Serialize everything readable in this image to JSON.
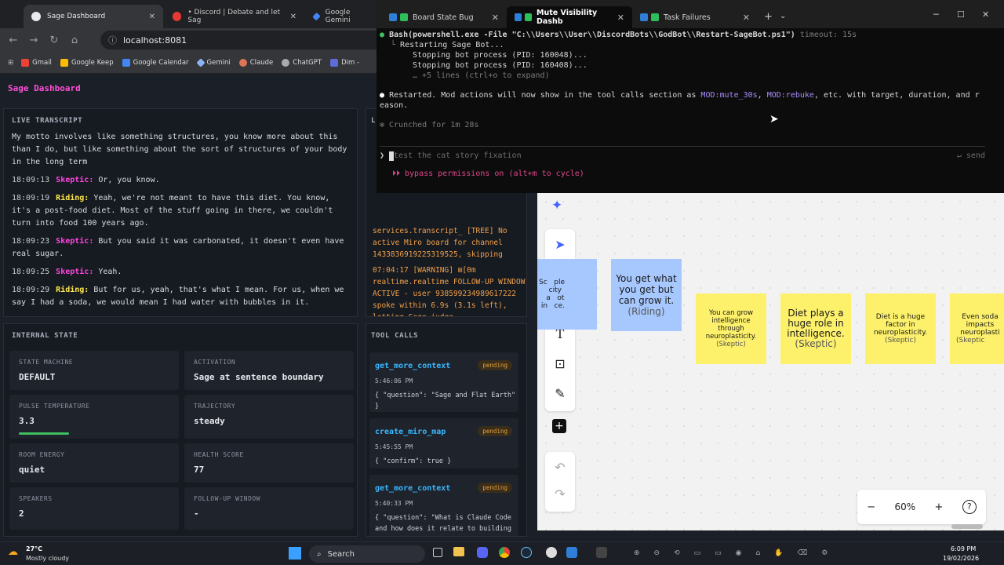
{
  "browser": {
    "tabs": [
      {
        "title": "Sage Dashboard",
        "active": true
      },
      {
        "title": "• Discord | Debate and let Sag"
      },
      {
        "title": "Google Gemini"
      }
    ],
    "url": "localhost:8081",
    "bookmarks": [
      "Gmail",
      "Google Keep",
      "Google Calendar",
      "Gemini",
      "Claude",
      "ChatGPT",
      "Dim -"
    ]
  },
  "dashboard": {
    "title": "Sage Dashboard",
    "transcript": {
      "header": "LIVE TRANSCRIPT",
      "lines": [
        {
          "time": "",
          "speaker": "",
          "text": "My motto involves like something structures, you know more about this than I do, but like something about the sort of structures of your body in the long term"
        },
        {
          "time": "18:09:13",
          "speaker": "Skeptic:",
          "text": "Or, you know."
        },
        {
          "time": "18:09:19",
          "speaker": "Riding:",
          "text": "Yeah, we're not meant to have this diet. You know, it's a post-food diet. Most of the stuff going in there, we couldn't turn into food 100 years ago."
        },
        {
          "time": "18:09:23",
          "speaker": "Skeptic:",
          "text": "But you said it was carbonated, it doesn't even have real sugar."
        },
        {
          "time": "18:09:25",
          "speaker": "Skeptic:",
          "text": "Yeah."
        },
        {
          "time": "18:09:29",
          "speaker": "Riding:",
          "text": "But for us, yeah, that's what I mean. For us, when we say I had a soda, we would mean I had water with bubbles in it."
        }
      ]
    },
    "logs": {
      "header": "L",
      "entries": [
        "services.transcript_ [TREE] No active Miro board for channel 1433836919225319525, skipping",
        "07:04:17  [WARNING] ⊠[0m realtime.realtime FOLLOW-UP WINDOW ACTIVE - user 938599234989617222 spoke within 6.9s (3.1s left), letting Sage judge"
      ]
    },
    "internal_state": {
      "header": "INTERNAL STATE",
      "cards": [
        {
          "label": "STATE MACHINE",
          "value": "DEFAULT"
        },
        {
          "label": "ACTIVATION",
          "value": "Sage at sentence boundary"
        },
        {
          "label": "PULSE TEMPERATURE",
          "value": "3.3"
        },
        {
          "label": "TRAJECTORY",
          "value": "steady"
        },
        {
          "label": "ROOM ENERGY",
          "value": "quiet"
        },
        {
          "label": "HEALTH SCORE",
          "value": "77"
        },
        {
          "label": "SPEAKERS",
          "value": "2"
        },
        {
          "label": "FOLLOW-UP WINDOW",
          "value": "-"
        }
      ]
    },
    "tool_calls": {
      "header": "TOOL CALLS",
      "items": [
        {
          "name": "get_more_context",
          "status": "pending",
          "time": "5:46:06 PM",
          "args": "{ \"question\": \"Sage and Flat Earth\" }"
        },
        {
          "name": "create_miro_map",
          "status": "pending",
          "time": "5:45:55 PM",
          "args": "{ \"confirm\": true }"
        },
        {
          "name": "get_more_context",
          "status": "pending",
          "time": "5:40:33 PM",
          "args": "{ \"question\": \"What is Claude Code and how does it relate to building Sage?\" }"
        }
      ]
    }
  },
  "terminal": {
    "tabs": [
      {
        "title": "Board State Bug"
      },
      {
        "title": "Mute Visibility Dashb",
        "active": true
      },
      {
        "title": "Task Failures"
      }
    ],
    "bash_cmd": "Bash(powershell.exe -File \"C:\\\\Users\\\\User\\\\DiscordBots\\\\GodBot\\\\Restart-SageBot.ps1\")",
    "timeout": "timeout: 15s",
    "out1": "Restarting Sage Bot...",
    "out2": "Stopping bot process (PID: 160048)...",
    "out3": "Stopping bot process (PID: 160408)...",
    "out4": "… +5 lines (ctrl+o to expand)",
    "msg_a": "Restarted. Mod actions will now show in the tool calls section as ",
    "msg_b": "MOD:mute_30s",
    "msg_c": ", ",
    "msg_d": "MOD:rebuke",
    "msg_e": ", etc. with target, duration, and r",
    "msg_f": "eason.",
    "crunched": "✻ Crunched for 1m 28s",
    "prompt_placeholder": "test the cat story fixation",
    "send": "↵ send",
    "bypass": "⏵⏵ bypass permissions on (alt+m to cycle)"
  },
  "miro": {
    "notes": [
      {
        "text": "Sc   ple\n   city\n   a   ot\n in   ce."
      },
      {
        "text": "You get what you get but can grow it.",
        "author": "(Riding)"
      },
      {
        "text": "You can grow intelligence through neuroplasticity.",
        "author": "(Skeptic)"
      },
      {
        "text": "Diet plays a huge role in intelligence.",
        "author": "(Skeptic)"
      },
      {
        "text": "Diet is a huge factor in neuroplasticity.",
        "author": "(Skeptic)"
      },
      {
        "text": "Even soda impacts neuroplasti",
        "author": "(Skeptic"
      }
    ],
    "zoom": "60%",
    "minus": "−",
    "plus": "+",
    "help": "?"
  },
  "taskbar": {
    "weather_temp": "27°C",
    "weather_desc": "Mostly cloudy",
    "search": "Search",
    "time": "6:09 PM",
    "date": "19/02/2026"
  }
}
